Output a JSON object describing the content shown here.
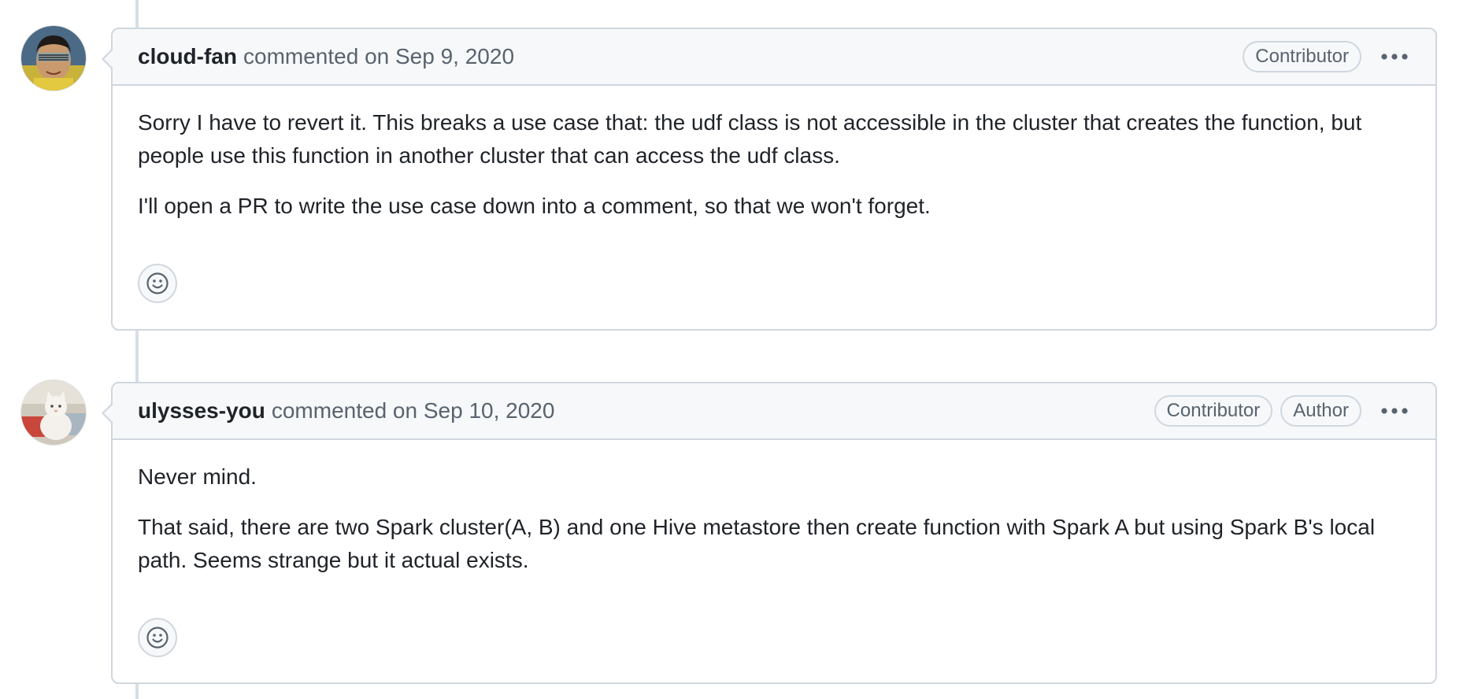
{
  "comments": [
    {
      "author": "cloud-fan",
      "meta": "commented on Sep 9, 2020",
      "badges": [
        "Contributor"
      ],
      "paragraphs": [
        "Sorry I have to revert it. This breaks a use case that: the udf class is not accessible in the cluster that creates the function, but people use this function in another cluster that can access the udf class.",
        "I'll open a PR to write the use case down into a comment, so that we won't forget."
      ],
      "avatar_icon": "user-avatar-sunglasses",
      "menu_icon": "kebab-horizontal-icon",
      "reaction_icon": "smiley-icon"
    },
    {
      "author": "ulysses-you",
      "meta": "commented on Sep 10, 2020",
      "badges": [
        "Contributor",
        "Author"
      ],
      "paragraphs": [
        "Never mind.",
        "That said, there are two Spark cluster(A, B) and one Hive metastore then create function with Spark A but using Spark B's local path. Seems strange but it actual exists."
      ],
      "avatar_icon": "user-avatar-cat",
      "menu_icon": "kebab-horizontal-icon",
      "reaction_icon": "smiley-icon"
    }
  ],
  "colors": {
    "border": "#d0d7de",
    "header_bg": "#f6f8fa",
    "text_primary": "#1f2328",
    "text_muted": "#59636e",
    "timeline": "#d8dee4"
  }
}
